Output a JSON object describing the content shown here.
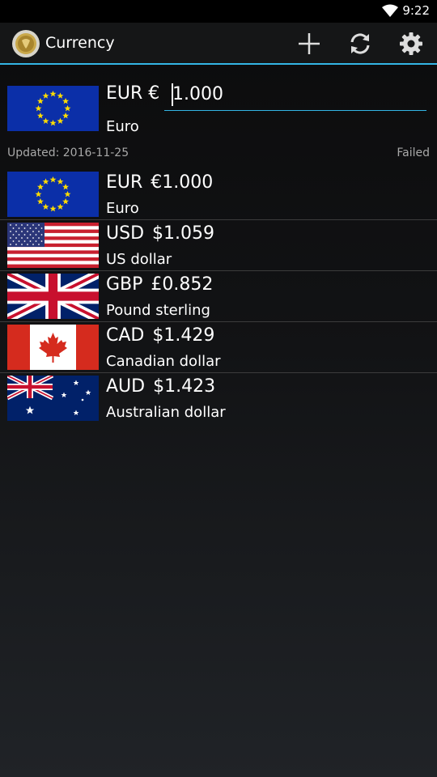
{
  "status_bar": {
    "time": "9:22"
  },
  "action_bar": {
    "title": "Currency",
    "actions": [
      "add-icon",
      "refresh-icon",
      "settings-icon"
    ]
  },
  "selected": {
    "code": "EUR",
    "symbol": "€",
    "name": "Euro",
    "value": "1.000",
    "flag": "eu-flag"
  },
  "status": {
    "updated": "Updated: 2016-11-25",
    "result": "Failed"
  },
  "currencies": [
    {
      "code": "EUR",
      "value": "€1.000",
      "name": "Euro",
      "flag": "eu-flag"
    },
    {
      "code": "USD",
      "value": "$1.059",
      "name": "US dollar",
      "flag": "us-flag"
    },
    {
      "code": "GBP",
      "value": "£0.852",
      "name": "Pound sterling",
      "flag": "uk-flag"
    },
    {
      "code": "CAD",
      "value": "$1.429",
      "name": "Canadian dollar",
      "flag": "canada-flag"
    },
    {
      "code": "AUD",
      "value": "$1.423",
      "name": "Australian dollar",
      "flag": "australia-flag"
    }
  ],
  "colors": {
    "accent": "#33b5e5",
    "divider": "#3c3c3c",
    "secondary_text": "#a8a8a8"
  }
}
